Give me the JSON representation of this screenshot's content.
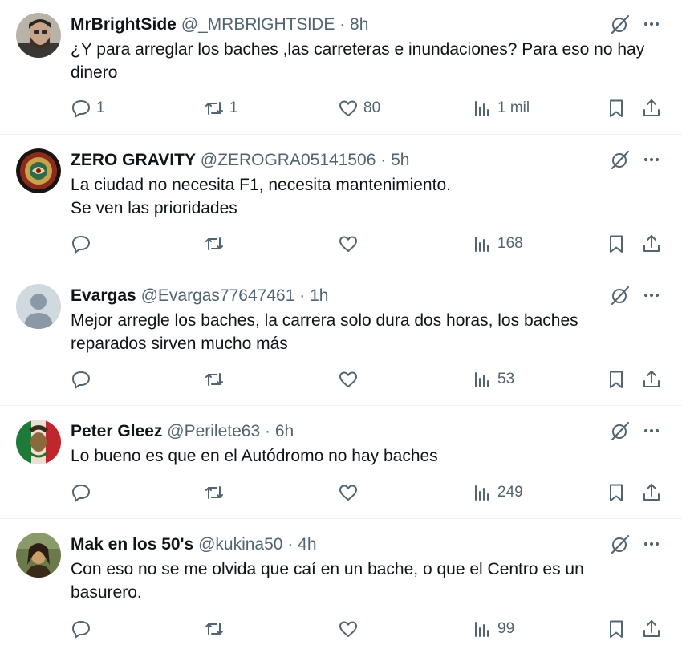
{
  "tweets": [
    {
      "name": "MrBrightSide",
      "handle": "@_MRBRlGHTSlDE",
      "separator": "·",
      "time": "8h",
      "lines": [
        "¿Y para arreglar los baches ,las carreteras e inundaciones? Para eso no hay",
        "dinero"
      ],
      "replies": "1",
      "reposts": "1",
      "likes": "80",
      "views": "1 mil"
    },
    {
      "name": "ZERO GRAVITY",
      "handle": "@ZEROGRA05141506",
      "separator": "·",
      "time": "5h",
      "lines": [
        "La ciudad no necesita F1, necesita mantenimiento.",
        "Se ven las prioridades"
      ],
      "replies": "",
      "reposts": "",
      "likes": "",
      "views": "168"
    },
    {
      "name": "Evargas",
      "handle": "@Evargas77647461",
      "separator": "·",
      "time": "1h",
      "lines": [
        "Mejor arregle los baches, la carrera solo dura dos horas, los baches",
        "reparados sirven mucho más"
      ],
      "replies": "",
      "reposts": "",
      "likes": "",
      "views": "53"
    },
    {
      "name": "Peter Gleez",
      "handle": "@Perilete63",
      "separator": "·",
      "time": "6h",
      "lines": [
        "Lo bueno es que en el Autódromo no hay baches"
      ],
      "replies": "",
      "reposts": "",
      "likes": "",
      "views": "249"
    },
    {
      "name": "Mak en los 50's",
      "handle": "@kukina50",
      "separator": "·",
      "time": "4h",
      "lines": [
        "Con eso no se me olvida que caí en un bache, o que el Centro es un",
        "basurero."
      ],
      "replies": "",
      "reposts": "",
      "likes": "",
      "views": "99"
    }
  ],
  "icons": {
    "reply": "reply-icon",
    "repost": "repost-icon",
    "like": "heart-icon",
    "views": "views-icon",
    "bookmark": "bookmark-icon",
    "share": "share-icon",
    "grok": "grok-icon",
    "more": "more-icon"
  },
  "colors": {
    "text": "#0f1419",
    "secondary": "#536471",
    "divider": "#eff3f4"
  }
}
